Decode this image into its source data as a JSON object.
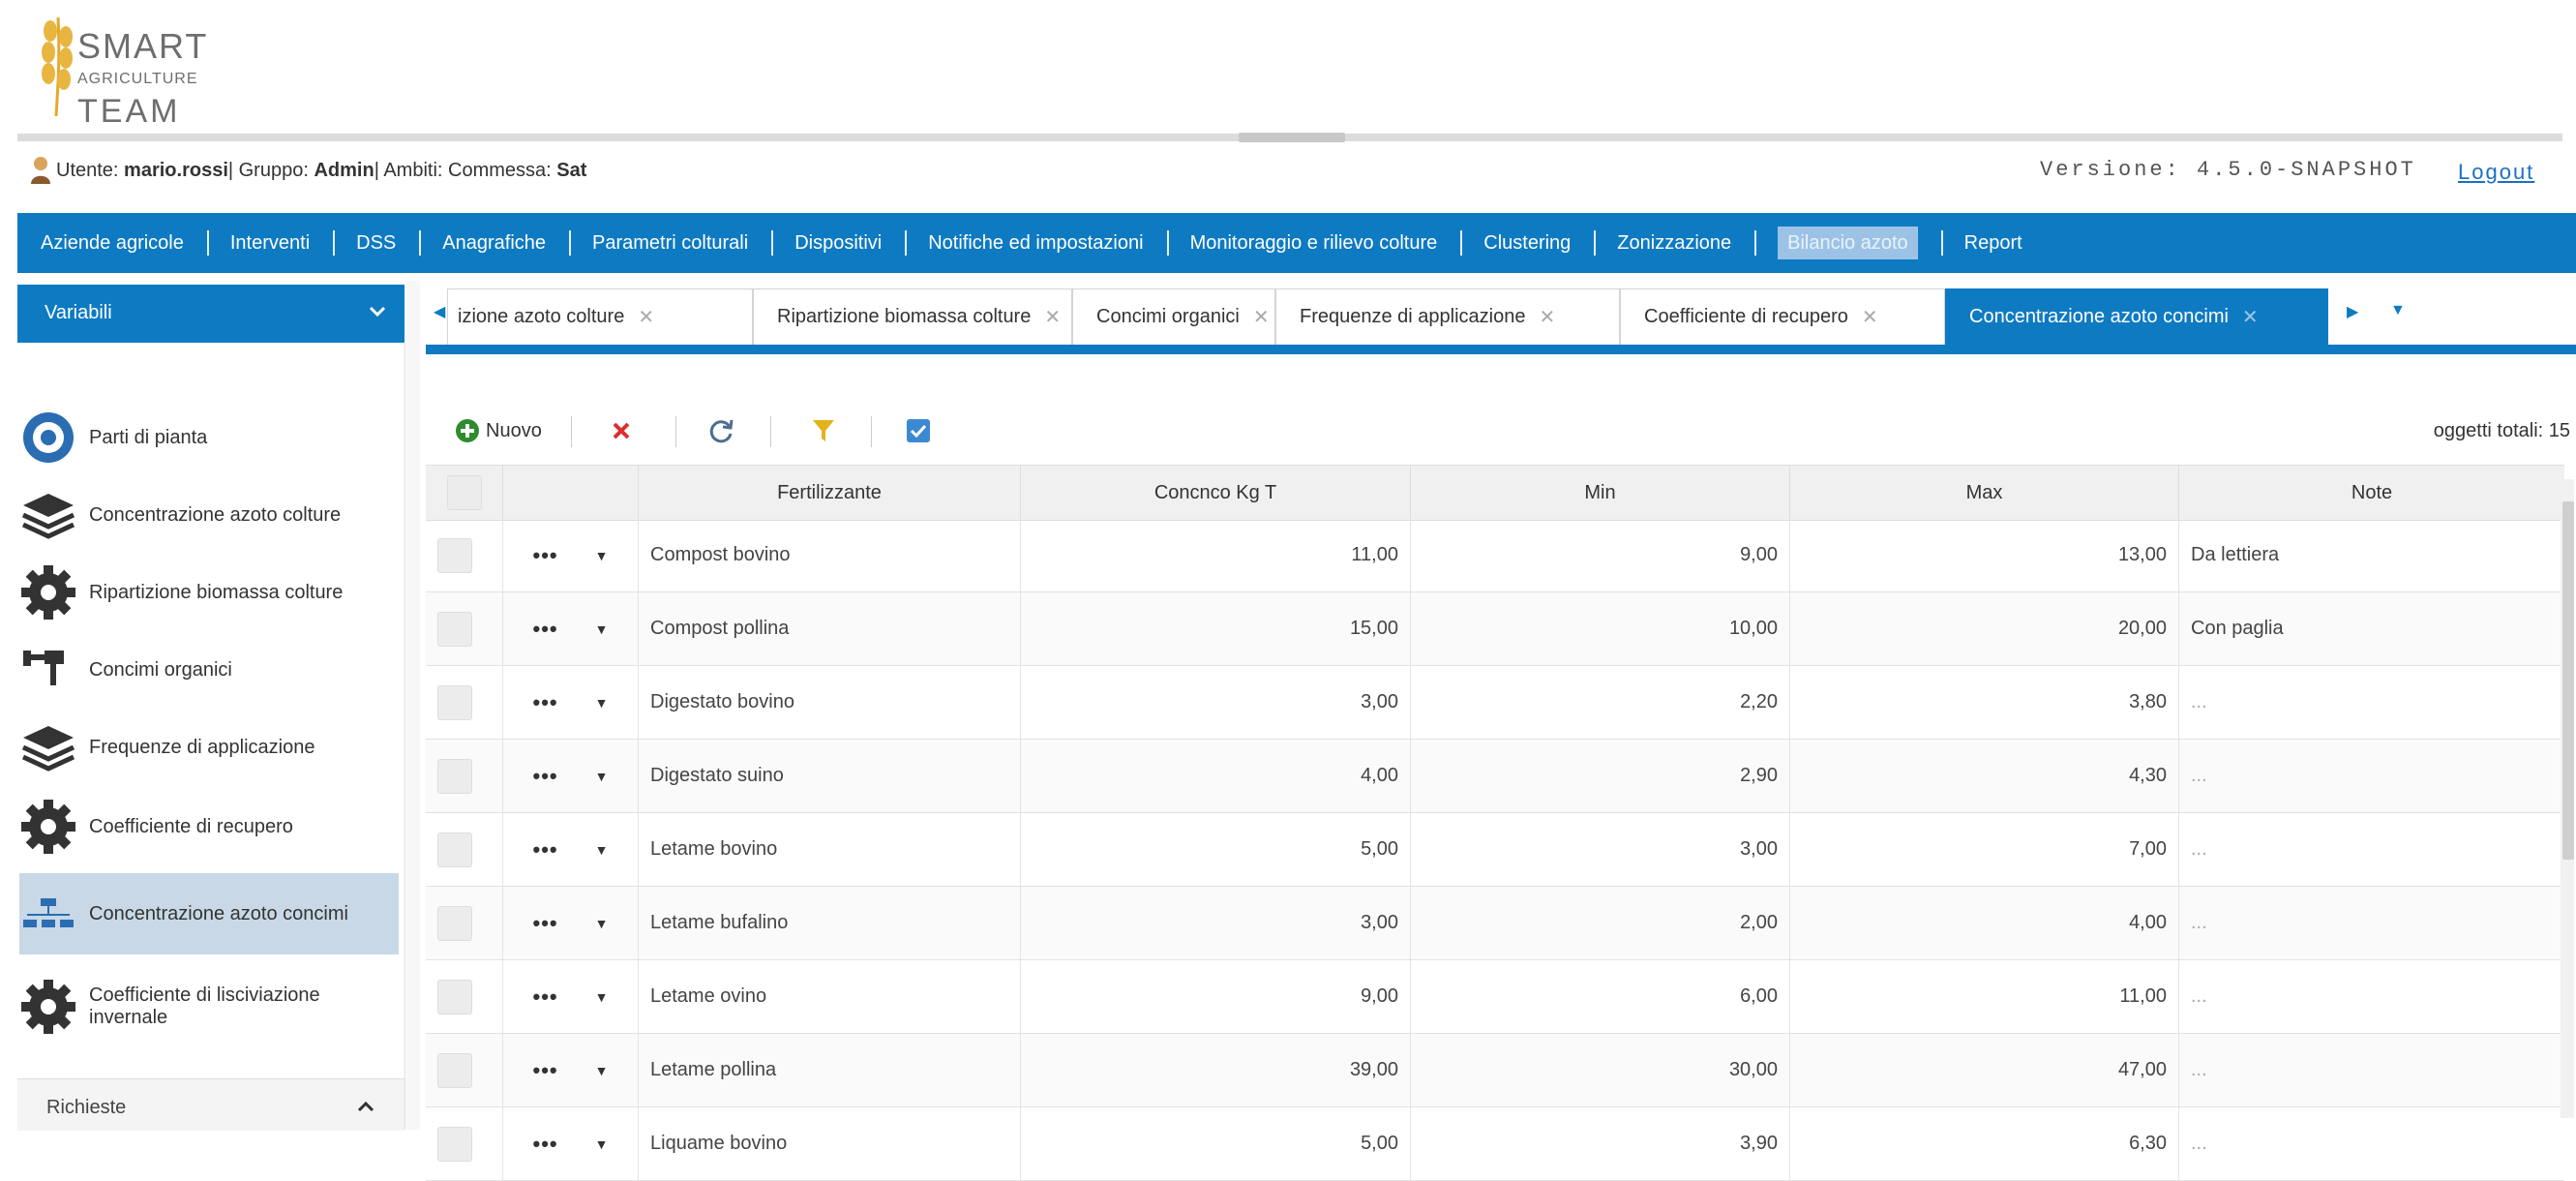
{
  "app": {
    "logo": {
      "line1": "SMART",
      "line2": "AGRICULTURE",
      "line3": "TEAM"
    },
    "user_line": {
      "prefix": "Utente: ",
      "user": "mario.rossi",
      "mid": " | Gruppo: ",
      "group": "Admin",
      "suffix": " | Ambiti: Commessa: ",
      "scope": "Sat"
    },
    "version": "Versione: 4.5.0-SNAPSHOT",
    "logout": "Logout",
    "accent": "#0e7ac2"
  },
  "nav": [
    "Aziende agricole",
    "Interventi",
    "DSS",
    "Anagrafiche",
    "Parametri colturali",
    "Dispositivi",
    "Notifiche ed impostazioni",
    "Monitoraggio e rilievo colture",
    "Clustering",
    "Zonizzazione",
    "Bilancio azoto",
    "Report"
  ],
  "nav_active": "Bilancio azoto",
  "sidebar": {
    "header": "Variabili",
    "items": [
      {
        "label": "Parti di pianta",
        "icon": "settings-cog-icon"
      },
      {
        "label": "Concentrazione azoto colture",
        "icon": "layers-icon"
      },
      {
        "label": "Ripartizione biomassa colture",
        "icon": "gear-icon"
      },
      {
        "label": "Concimi organici",
        "icon": "tools-icon"
      },
      {
        "label": "Frequenze di applicazione",
        "icon": "layers-icon"
      },
      {
        "label": "Coefficiente di recupero",
        "icon": "gear-icon"
      },
      {
        "label": "Concentrazione azoto concimi",
        "icon": "hierarchy-icon"
      },
      {
        "label": "Coefficiente di lisciviazione invernale",
        "icon": "gear-icon"
      }
    ],
    "active": "Concentrazione azoto concimi",
    "footer": "Richieste"
  },
  "tabs": [
    {
      "label": "izione azoto colture"
    },
    {
      "label": "Ripartizione biomassa colture"
    },
    {
      "label": "Concimi organici"
    },
    {
      "label": "Frequenze di applicazione"
    },
    {
      "label": "Coefficiente di recupero"
    },
    {
      "label": "Concentrazione azoto concimi",
      "active": true
    }
  ],
  "toolbar": {
    "new_label": "Nuovo",
    "total_label": "oggetti totali: 15"
  },
  "grid": {
    "columns": [
      "Fertilizzante",
      "Concnco Kg T",
      "Min",
      "Max",
      "Note"
    ],
    "rows": [
      [
        "Compost bovino",
        "11,00",
        "9,00",
        "13,00",
        "Da lettiera"
      ],
      [
        "Compost pollina",
        "15,00",
        "10,00",
        "20,00",
        "Con paglia"
      ],
      [
        "Digestato bovino",
        "3,00",
        "2,20",
        "3,80",
        "..."
      ],
      [
        "Digestato suino",
        "4,00",
        "2,90",
        "4,30",
        "..."
      ],
      [
        "Letame bovino",
        "5,00",
        "3,00",
        "7,00",
        "..."
      ],
      [
        "Letame bufalino",
        "3,00",
        "2,00",
        "4,00",
        "..."
      ],
      [
        "Letame ovino",
        "9,00",
        "6,00",
        "11,00",
        "..."
      ],
      [
        "Letame pollina",
        "39,00",
        "30,00",
        "47,00",
        "..."
      ],
      [
        "Liquame bovino",
        "5,00",
        "3,90",
        "6,30",
        "..."
      ]
    ]
  }
}
